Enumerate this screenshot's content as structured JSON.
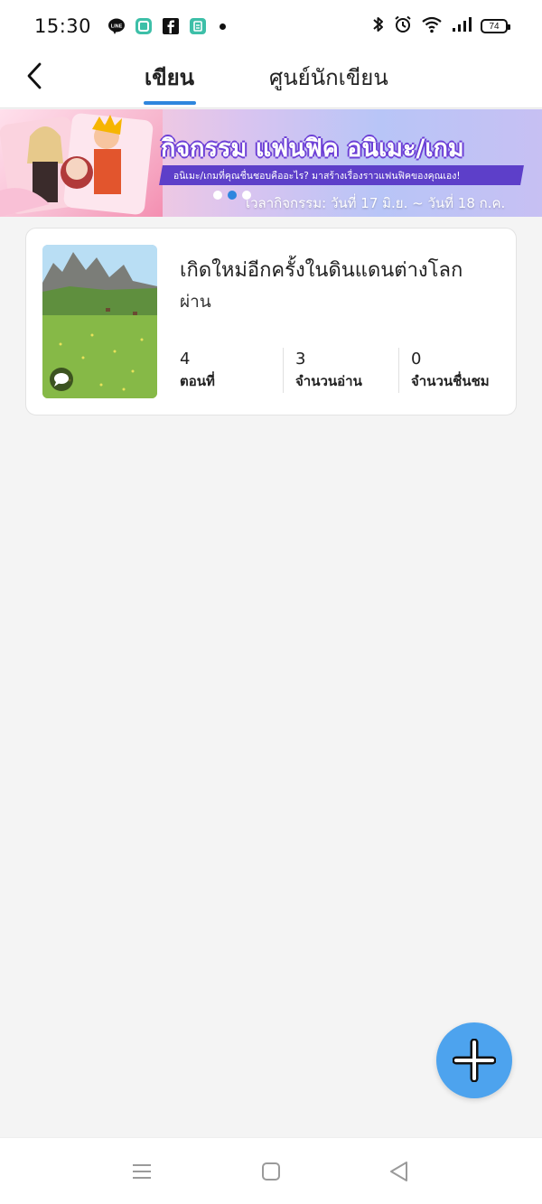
{
  "status_bar": {
    "time": "15:30",
    "battery": "74",
    "left_icons": [
      "line-icon",
      "square-app-icon",
      "facebook-icon",
      "calendar-app-icon",
      "notification-dot"
    ],
    "right_icons": [
      "bluetooth-icon",
      "alarm-icon",
      "wifi-icon",
      "signal-icon",
      "battery-icon"
    ]
  },
  "header": {
    "tabs": [
      {
        "label": "เขียน",
        "active": true
      },
      {
        "label": "ศูนย์นักเขียน",
        "active": false
      }
    ],
    "accent_color": "#2e86de"
  },
  "banner": {
    "title": "กิจกรรม แฟนฟิค อนิเมะ/เกม",
    "subtitle": "อนิเมะ/เกมที่คุณชื่นชอบคืออะไร? มาสร้างเรื่องราวแฟนฟิคของคุณเอง!",
    "date_text": "เวลากิจกรรม: วันที่ 17 มิ.ย. ~ วันที่ 18 ก.ค."
  },
  "story": {
    "title": "เกิดใหม่อีกครั้งในดินแดนต่างโลก",
    "status": "ผ่าน",
    "stats": [
      {
        "value": "4",
        "label": "ตอนที่"
      },
      {
        "value": "3",
        "label": "จำนวนอ่าน"
      },
      {
        "value": "0",
        "label": "จำนวนชื่นชม"
      }
    ]
  },
  "fab": {
    "icon": "plus-icon",
    "color": "#4da3ee"
  },
  "nav_bar": {
    "icons": [
      "menu-icon",
      "home-icon",
      "back-triangle-icon"
    ]
  }
}
